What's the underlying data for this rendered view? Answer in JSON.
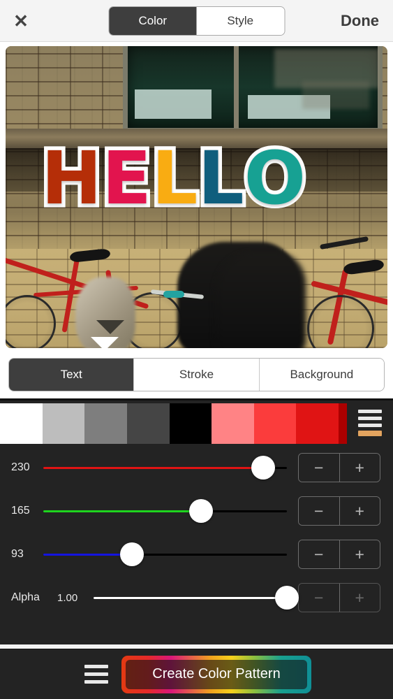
{
  "header": {
    "close_icon": "close-icon",
    "segments": [
      {
        "label": "Color",
        "active": true
      },
      {
        "label": "Style",
        "active": false
      }
    ],
    "done_label": "Done"
  },
  "preview": {
    "overlay_text": "HELLO",
    "letters": [
      {
        "char": "H",
        "color": "#b52e08"
      },
      {
        "char": "E",
        "color": "#e2144e"
      },
      {
        "char": "L",
        "color": "#f9ac12"
      },
      {
        "char": "L",
        "color": "#0f5e7d"
      },
      {
        "char": "O",
        "color": "#17a193"
      }
    ],
    "stroke_color": "#ffffff",
    "scene": "brick wall with red bicycles and blurred person"
  },
  "target_tabs": [
    {
      "label": "Text",
      "active": true
    },
    {
      "label": "Stroke",
      "active": false
    },
    {
      "label": "Background",
      "active": false
    }
  ],
  "swatches": {
    "colors": [
      "#ffffff",
      "#bdbdbd",
      "#7e7e7e",
      "#454545",
      "#000000",
      "#ff8385",
      "#fb3c3c",
      "#e01414",
      "#ab0000"
    ],
    "menu_icon": "swatch-menu-icon",
    "menu_accent_color": "#e3a45f"
  },
  "sliders": [
    {
      "name": "red",
      "label": "230",
      "value": 230,
      "max": 255,
      "percent": 90.2,
      "color": "#e01414"
    },
    {
      "name": "green",
      "label": "165",
      "value": 165,
      "max": 255,
      "percent": 64.7,
      "color": "#1ed41e"
    },
    {
      "name": "blue",
      "label": "93",
      "value": 93,
      "max": 255,
      "percent": 36.5,
      "color": "#1414e0"
    },
    {
      "name": "alpha",
      "label": "Alpha",
      "value_label": "1.00",
      "value": 1,
      "max": 1,
      "percent": 100,
      "color": "#ffffff"
    }
  ],
  "stepper": {
    "minus_label": "−",
    "plus_label": "+"
  },
  "bottom": {
    "menu_icon": "bottom-menu-icon",
    "cta_label": "Create Color Pattern"
  }
}
